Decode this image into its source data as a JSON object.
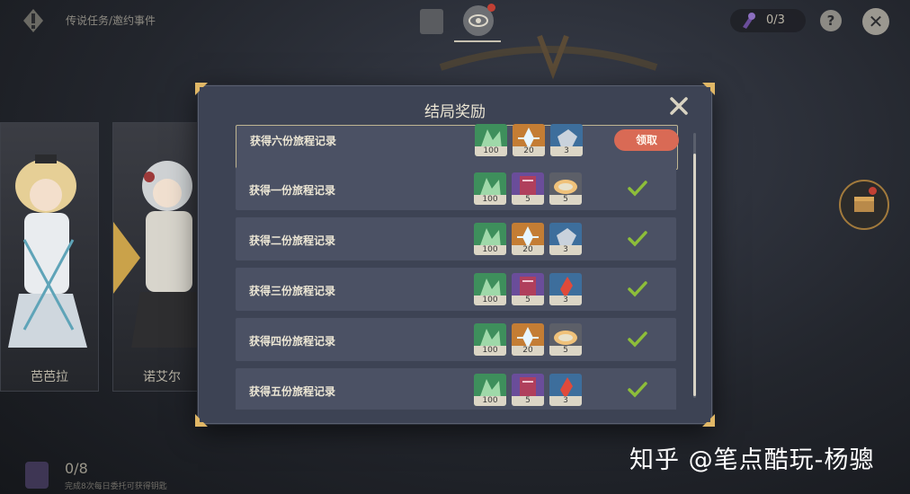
{
  "header": {
    "title": "传说任务/邀约事件",
    "key_count": "0/3",
    "help_label": "?",
    "close_label": "✕"
  },
  "characters": [
    {
      "name": "芭芭拉"
    },
    {
      "name": "诺艾尔"
    }
  ],
  "footer": {
    "count": "0/8",
    "note": "完成8次每日委托可获得钥匙"
  },
  "watermark": "知乎 @笔点酷玩-杨骢",
  "dialog": {
    "title": "结局奖励",
    "claim_label": "领取",
    "rows": [
      {
        "label": "获得六份旅程记录",
        "status": "claimable",
        "items": [
          {
            "icon": "adventure-exp-icon",
            "qty": "100"
          },
          {
            "icon": "primogem-icon",
            "qty": "20"
          },
          {
            "icon": "mystic-ore-icon",
            "qty": "3"
          }
        ]
      },
      {
        "label": "获得一份旅程记录",
        "status": "claimed",
        "items": [
          {
            "icon": "adventure-exp-icon",
            "qty": "100"
          },
          {
            "icon": "talent-book-icon",
            "qty": "5"
          },
          {
            "icon": "dish-icon",
            "qty": "5"
          }
        ]
      },
      {
        "label": "获得二份旅程记录",
        "status": "claimed",
        "items": [
          {
            "icon": "adventure-exp-icon",
            "qty": "100"
          },
          {
            "icon": "primogem-icon",
            "qty": "20"
          },
          {
            "icon": "mystic-ore-icon",
            "qty": "3"
          }
        ]
      },
      {
        "label": "获得三份旅程记录",
        "status": "claimed",
        "items": [
          {
            "icon": "adventure-exp-icon",
            "qty": "100"
          },
          {
            "icon": "talent-book-icon",
            "qty": "5"
          },
          {
            "icon": "red-crystal-icon",
            "qty": "3"
          }
        ]
      },
      {
        "label": "获得四份旅程记录",
        "status": "claimed",
        "items": [
          {
            "icon": "adventure-exp-icon",
            "qty": "100"
          },
          {
            "icon": "primogem-icon",
            "qty": "20"
          },
          {
            "icon": "dish-icon",
            "qty": "5"
          }
        ]
      },
      {
        "label": "获得五份旅程记录",
        "status": "claimed",
        "items": [
          {
            "icon": "adventure-exp-icon",
            "qty": "100"
          },
          {
            "icon": "talent-book-icon",
            "qty": "5"
          },
          {
            "icon": "red-crystal-icon",
            "qty": "3"
          }
        ]
      }
    ]
  },
  "colors": {
    "accent": "#d96a55",
    "check": "#8dbe3a",
    "dialog_bg": "#3d4354",
    "row_bg": "#4b5164"
  }
}
